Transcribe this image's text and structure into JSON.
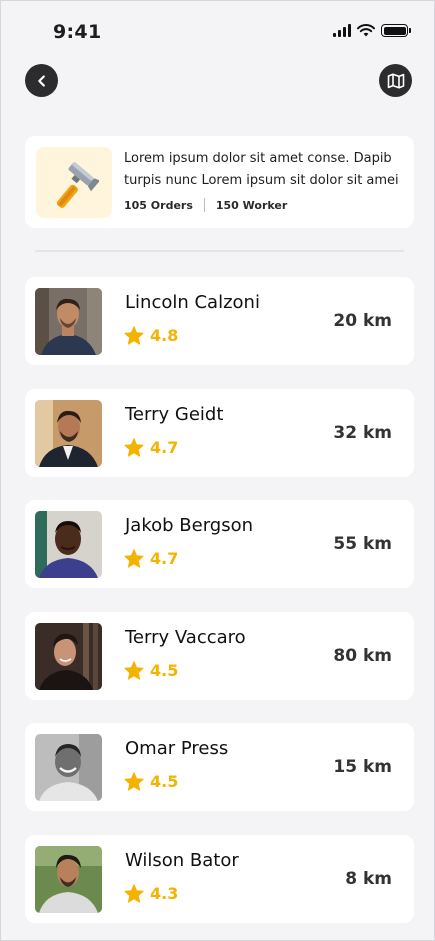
{
  "status_bar": {
    "time": "9:41"
  },
  "header": {
    "back_icon": "chevron-left-icon",
    "map_icon": "map-icon"
  },
  "category": {
    "icon": "hammer-icon",
    "description": "Lorem ipsum dolor sit amet conse. Dapib\nturpis nunc Lorem ipsum sit dolor sit amei",
    "orders": "105 Orders",
    "workers": "150 Worker"
  },
  "colors": {
    "accent_star": "#f5b301",
    "dark_button": "#2c2c2e"
  },
  "workers": [
    {
      "name": "Lincoln Calzoni",
      "rating": "4.8",
      "distance": "20 km"
    },
    {
      "name": "Terry Geidt",
      "rating": "4.7",
      "distance": "32 km"
    },
    {
      "name": "Jakob Bergson",
      "rating": "4.7",
      "distance": "55 km"
    },
    {
      "name": "Terry Vaccaro",
      "rating": "4.5",
      "distance": "80 km"
    },
    {
      "name": "Omar Press",
      "rating": "4.5",
      "distance": "15 km"
    },
    {
      "name": "Wilson Bator",
      "rating": "4.3",
      "distance": "8 km"
    }
  ]
}
